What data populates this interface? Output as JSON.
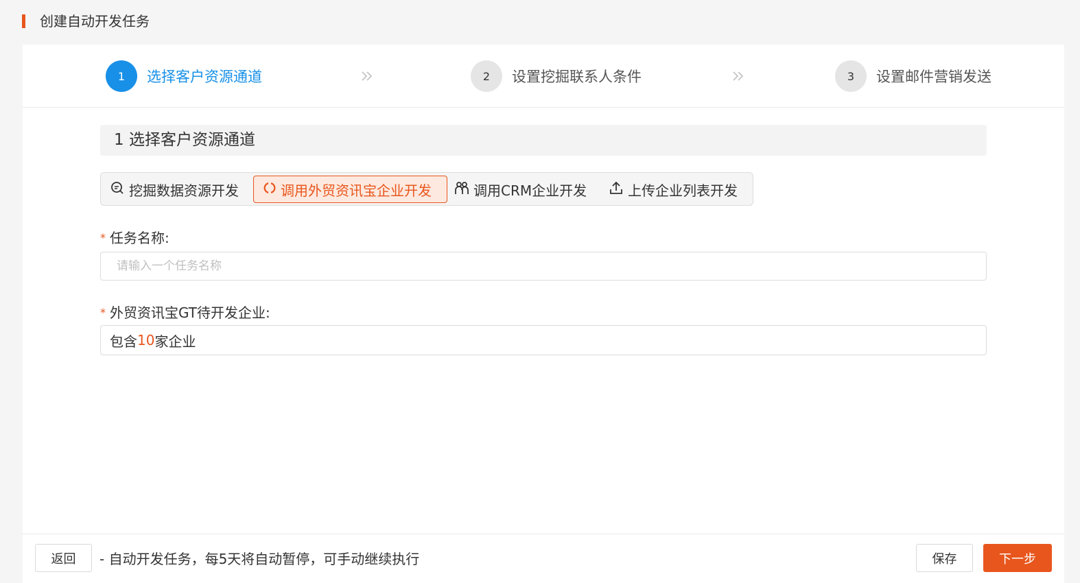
{
  "header": {
    "title": "创建自动开发任务"
  },
  "steps": [
    {
      "num": "1",
      "label": "选择客户资源通道",
      "active": true
    },
    {
      "num": "2",
      "label": "设置挖掘联系人条件",
      "active": false
    },
    {
      "num": "3",
      "label": "设置邮件营销发送",
      "active": false
    }
  ],
  "section": {
    "title": "1 选择客户资源通道"
  },
  "tabs": [
    {
      "label": "挖掘数据资源开发",
      "icon": "search-doc-icon"
    },
    {
      "label": "调用外贸资讯宝企业开发",
      "icon": "loading-ring-icon"
    },
    {
      "label": "调用CRM企业开发",
      "icon": "users-icon"
    },
    {
      "label": "上传企业列表开发",
      "icon": "upload-icon"
    }
  ],
  "task_name": {
    "required_mark": "*",
    "label": "任务名称:",
    "placeholder": "请输入一个任务名称",
    "value": ""
  },
  "enterprises": {
    "required_mark": "*",
    "label": "外贸资讯宝GT待开发企业:",
    "prefix": "包含",
    "count": "10",
    "suffix": "家企业"
  },
  "footer": {
    "back_label": "返回",
    "note": "- 自动开发任务，每5天将自动暂停，可手动继续执行",
    "save_label": "保存",
    "next_label": "下一步"
  },
  "colors": {
    "accent": "#e8561d",
    "active_step": "#1890e8"
  }
}
